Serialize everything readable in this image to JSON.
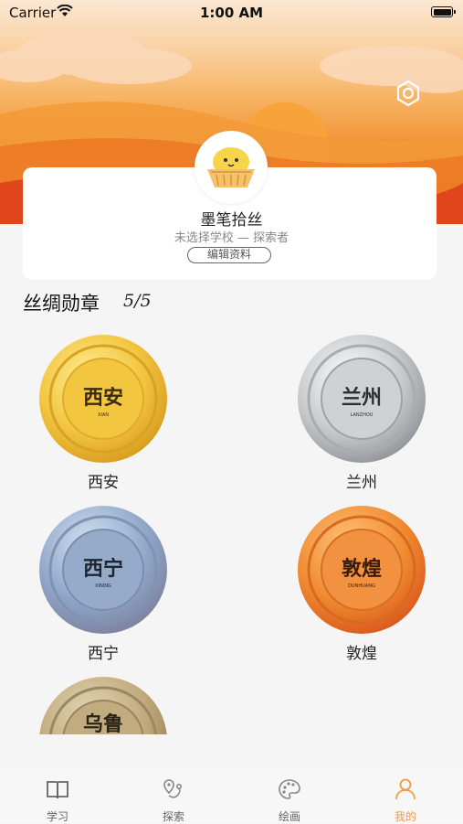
{
  "status_bar": {
    "carrier": "Carrier",
    "time": "1:00 AM"
  },
  "profile": {
    "name": "墨笔拾丝",
    "subtitle": "未选择学校 — 探索者",
    "edit_label": "编辑资料"
  },
  "medals_section": {
    "title": "丝绸勋章",
    "count": "5/5"
  },
  "medals": [
    {
      "city": "西安",
      "pinyin": "XIAN",
      "label": "西安",
      "color": "#f2c43f"
    },
    {
      "city": "兰州",
      "pinyin": "LANZHOU",
      "label": "兰州",
      "color": "#c7c9cc"
    },
    {
      "city": "西宁",
      "pinyin": "XINING",
      "label": "西宁",
      "color": "#8fa6c8"
    },
    {
      "city": "敦煌",
      "pinyin": "DUNHUANG",
      "label": "敦煌",
      "color": "#f08a2f"
    },
    {
      "city": "乌鲁",
      "label": "",
      "color": "#bfa87a"
    }
  ],
  "tabs": [
    {
      "label": "学习",
      "icon": "book-icon"
    },
    {
      "label": "探索",
      "icon": "map-pin-route-icon"
    },
    {
      "label": "绘画",
      "icon": "palette-icon"
    },
    {
      "label": "我的",
      "icon": "person-icon",
      "active": true
    }
  ],
  "colors": {
    "accent": "#f19a46"
  }
}
